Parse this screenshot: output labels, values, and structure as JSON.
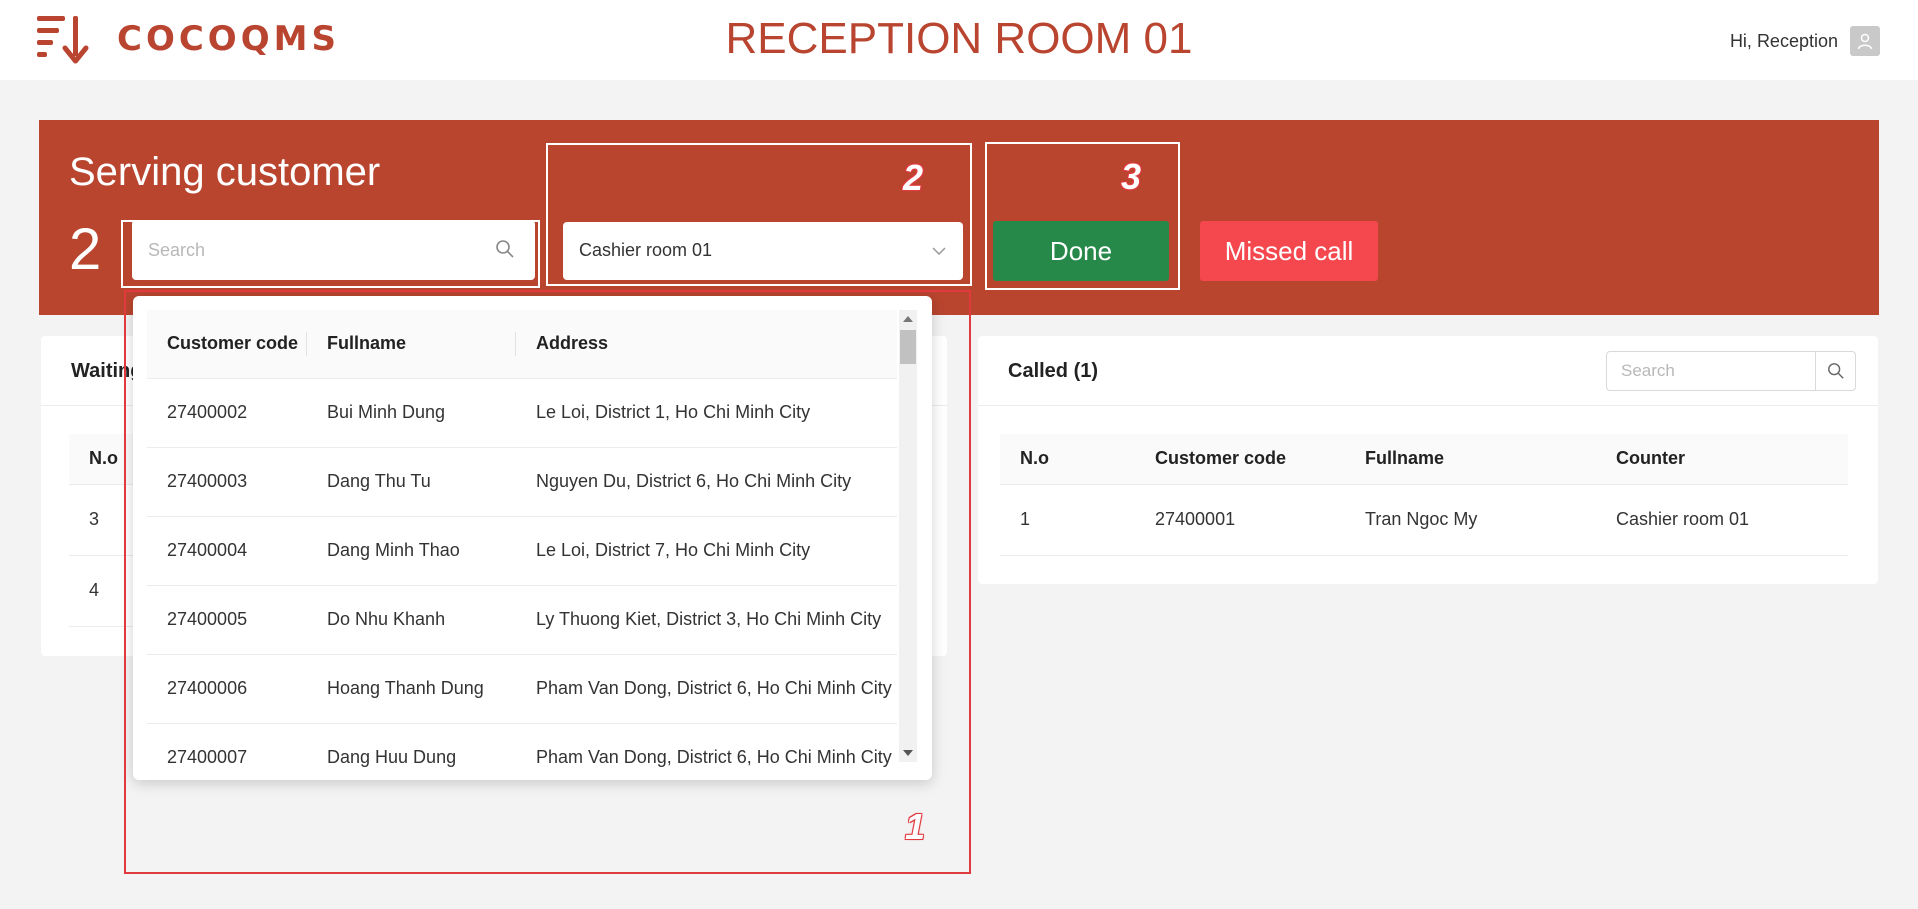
{
  "header": {
    "logo_text": "COCOQMS",
    "title": "RECEPTION ROOM 01",
    "greeting": "Hi, Reception"
  },
  "serving": {
    "title": "Serving customer",
    "count": "2",
    "search_placeholder": "Search",
    "counter_value": "Cashier room 01",
    "done_label": "Done",
    "missed_label": "Missed call"
  },
  "annotations": [
    "1",
    "2",
    "3"
  ],
  "waiting": {
    "title": "Waiting",
    "columns": [
      "N.o"
    ],
    "rows": [
      [
        "3"
      ],
      [
        "4"
      ]
    ]
  },
  "called": {
    "title": "Called (1)",
    "search_placeholder": "Search",
    "columns": [
      "N.o",
      "Customer code",
      "Fullname",
      "Counter"
    ],
    "rows": [
      [
        "1",
        "27400001",
        "Tran Ngoc My",
        "Cashier room 01"
      ]
    ]
  },
  "dropdown": {
    "columns": [
      "Customer code",
      "Fullname",
      "Address"
    ],
    "rows": [
      [
        "27400002",
        "Bui Minh Dung",
        "Le Loi, District 1, Ho Chi Minh City"
      ],
      [
        "27400003",
        "Dang Thu Tu",
        "Nguyen Du, District 6, Ho Chi Minh City"
      ],
      [
        "27400004",
        "Dang Minh Thao",
        "Le Loi, District 7, Ho Chi Minh City"
      ],
      [
        "27400005",
        "Do Nhu Khanh",
        "Ly Thuong Kiet, District 3, Ho Chi Minh City"
      ],
      [
        "27400006",
        "Hoang Thanh Dung",
        "Pham Van Dong, District 6, Ho Chi Minh City"
      ],
      [
        "27400007",
        "Dang Huu Dung",
        "Pham Van Dong, District 6, Ho Chi Minh City"
      ]
    ]
  },
  "colors": {
    "brand": "#b9442f",
    "banner": "#b9452f",
    "done": "#26894a",
    "missed": "#f4474e",
    "annotation_red": "#e03a3f"
  },
  "icons": [
    "logo-icon",
    "user-icon",
    "search-icon",
    "chevron-down-icon"
  ]
}
